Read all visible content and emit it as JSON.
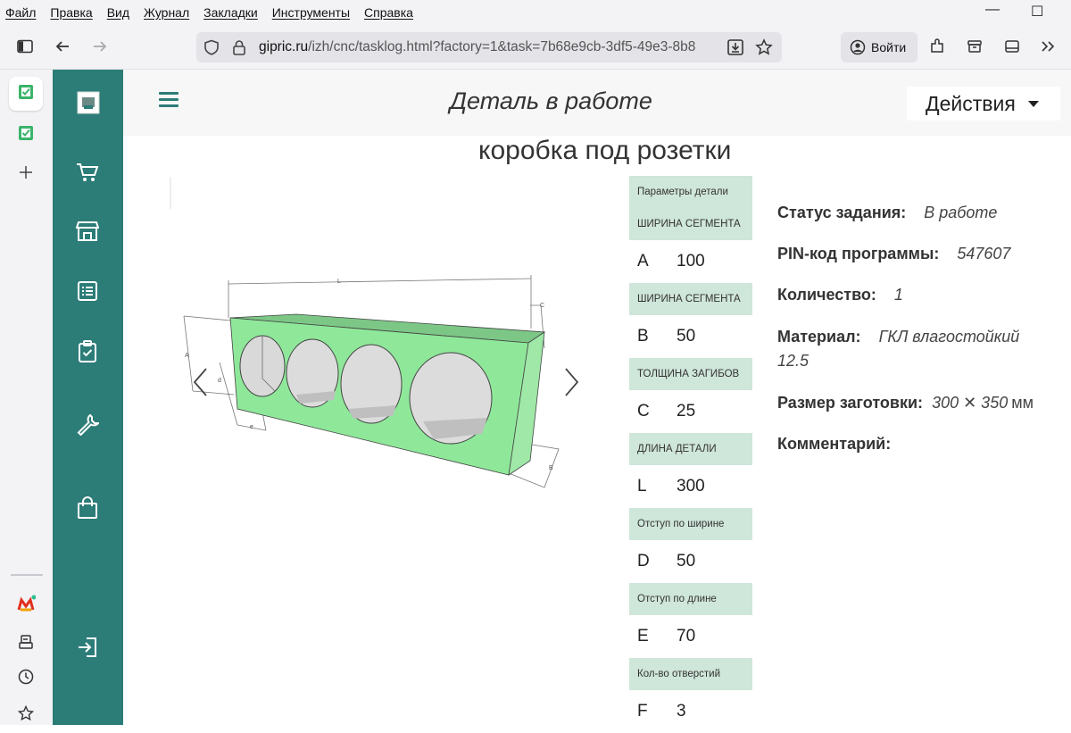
{
  "menu": [
    "Файл",
    "Правка",
    "Вид",
    "Журнал",
    "Закладки",
    "Инструменты",
    "Справка"
  ],
  "window_controls": {
    "minimize": "—",
    "maximize": "☐"
  },
  "address_bar": {
    "domain": "gipric.ru",
    "path": "/izh/cnc/tasklog.html?factory=1&task=7b68e9cb-3df5-49e3-8b8"
  },
  "signin_label": "Войти",
  "header": {
    "title": "Деталь в работе",
    "actions_label": "Действия"
  },
  "part_name": "коробка под розетки",
  "params_title": "Параметры детали",
  "params": [
    {
      "header": "ШИРИНА СЕГМЕНТА",
      "key": "A",
      "value": "100"
    },
    {
      "header": "ШИРИНА СЕГМЕНТА",
      "key": "B",
      "value": "50"
    },
    {
      "header": "ТОЛЩИНА ЗАГИБОВ",
      "key": "C",
      "value": "25"
    },
    {
      "header": "ДЛИНА ДЕТАЛИ",
      "key": "L",
      "value": "300"
    },
    {
      "header": "Отступ по ширине",
      "key": "D",
      "value": "50"
    },
    {
      "header": "Отступ по длине",
      "key": "E",
      "value": "70"
    },
    {
      "header": "Кол-во отверстий",
      "key": "F",
      "value": "3"
    }
  ],
  "info": {
    "status_label": "Статус задания:",
    "status_value": "В работе",
    "pin_label": "PIN-код программы:",
    "pin_value": "547607",
    "qty_label": "Количество:",
    "qty_value": "1",
    "material_label": "Материал:",
    "material_value_1": "ГКЛ влагостойкий",
    "material_value_2": "12.5",
    "size_label": "Размер заготовки:",
    "size_value": "300 ✕ 350",
    "size_unit": "мм",
    "comment_label": "Комментарий:"
  },
  "drawing_labels": {
    "L": "L",
    "C": "C",
    "A": "A",
    "B": "B",
    "d": "d",
    "e": "e"
  },
  "colors": {
    "accent": "#2c7c78",
    "param_header": "#cfe6da",
    "part_green": "#8fe89a"
  }
}
